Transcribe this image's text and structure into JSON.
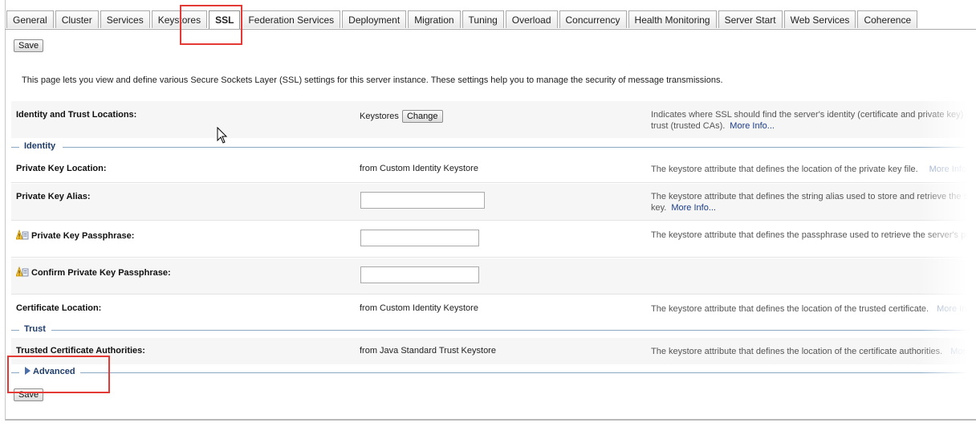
{
  "tabs": [
    "General",
    "Cluster",
    "Services",
    "Keystores",
    "SSL",
    "Federation Services",
    "Deployment",
    "Migration",
    "Tuning",
    "Overload",
    "Concurrency",
    "Health Monitoring",
    "Server Start",
    "Web Services",
    "Coherence"
  ],
  "active_tab": "SSL",
  "save_label": "Save",
  "intro": "This page lets you view and define various Secure Sockets Layer (SSL) settings for this server instance. These settings help you to manage the security of message transmissions.",
  "identity_trust": {
    "label": "Identity and Trust Locations:",
    "value": "Keystores",
    "change_label": "Change",
    "desc_line1": "Indicates where SSL should find the server's identity (certificate and private key) a",
    "desc_line2": "trust (trusted CAs).",
    "more": "More Info..."
  },
  "sections": {
    "identity": "Identity",
    "trust": "Trust",
    "advanced": "Advanced"
  },
  "rows": {
    "pk_location": {
      "label": "Private Key Location:",
      "value": "from Custom Identity Keystore",
      "desc": "The keystore attribute that defines the location of the private key file.",
      "more": "More Info..."
    },
    "pk_alias": {
      "label": "Private Key Alias:",
      "value": "",
      "desc_line1": "The keystore attribute that defines the string alias used to store and retrieve the se",
      "desc_line2": "key.",
      "more": "More Info..."
    },
    "pk_pass": {
      "label": "Private Key Passphrase:",
      "value": "",
      "desc": "The keystore attribute that defines the passphrase used to retrieve the server's priv"
    },
    "pk_confirm": {
      "label": "Confirm Private Key Passphrase:",
      "value": ""
    },
    "cert_location": {
      "label": "Certificate Location:",
      "value": "from Custom Identity Keystore",
      "desc": "The keystore attribute that defines the location of the trusted certificate.",
      "more": "More Info..."
    },
    "trusted_ca": {
      "label": "Trusted Certificate Authorities:",
      "value": "from Java Standard Trust Keystore",
      "desc": "The keystore attribute that defines the location of the certificate authorities.",
      "more": "More Info..."
    }
  },
  "colors": {
    "highlight": "#e53935",
    "link": "#1a3c8a",
    "section": "#1f3d6b"
  }
}
